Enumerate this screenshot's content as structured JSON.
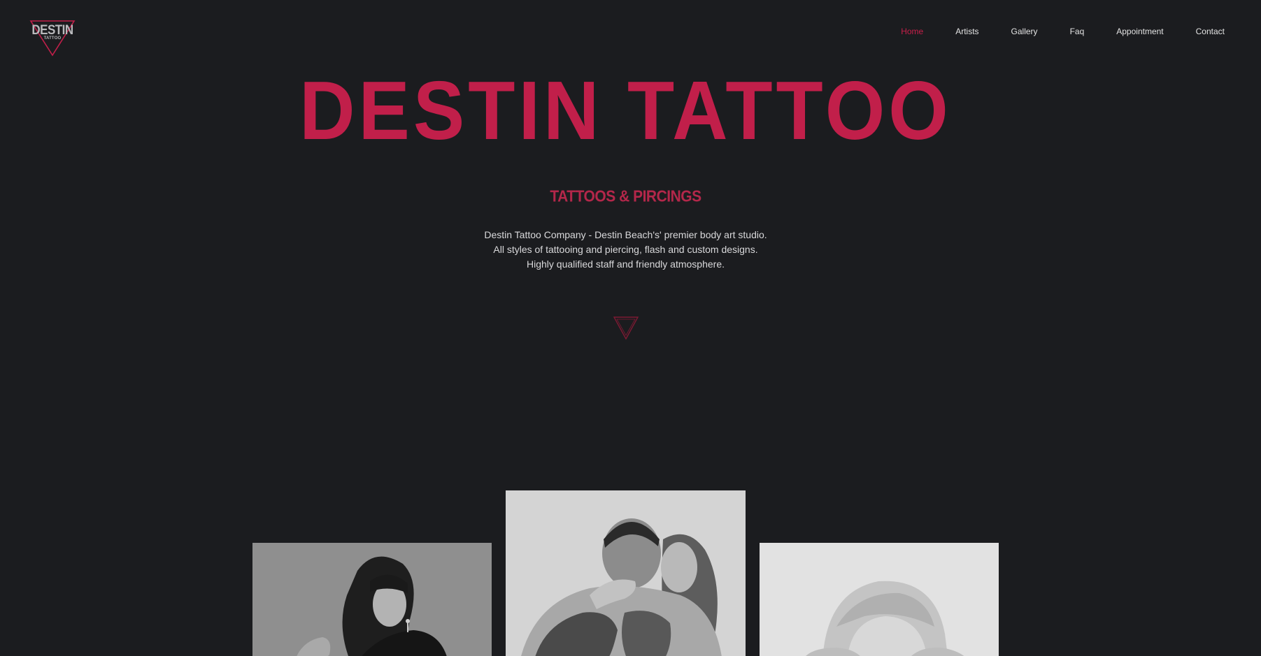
{
  "brand": {
    "logo_main": "DESTIN",
    "logo_sub": "TATTOO",
    "accent_color": "#c11f4a",
    "background_color": "#1b1c1f"
  },
  "nav": {
    "items": [
      {
        "label": "Home",
        "active": true
      },
      {
        "label": "Artists",
        "active": false
      },
      {
        "label": "Gallery",
        "active": false
      },
      {
        "label": "Faq",
        "active": false
      },
      {
        "label": "Appointment",
        "active": false
      },
      {
        "label": "Contact",
        "active": false
      }
    ]
  },
  "hero": {
    "title": "DESTIN TATTOO",
    "subtitle": "TATTOOS & PIRCINGS",
    "description_lines": [
      "Destin Tattoo Company - Destin Beach's' premier body art studio.",
      "All styles of tattooing and piercing, flash and custom designs.",
      "Highly qualified staff and friendly atmosphere."
    ],
    "scroll_icon": "triangle-down-icon"
  },
  "gallery": {
    "photos": [
      {
        "subject": "woman-with-long-hair-photo"
      },
      {
        "subject": "tattooed-couple-photo"
      },
      {
        "subject": "blonde-woman-covering-eyes-photo"
      }
    ]
  }
}
